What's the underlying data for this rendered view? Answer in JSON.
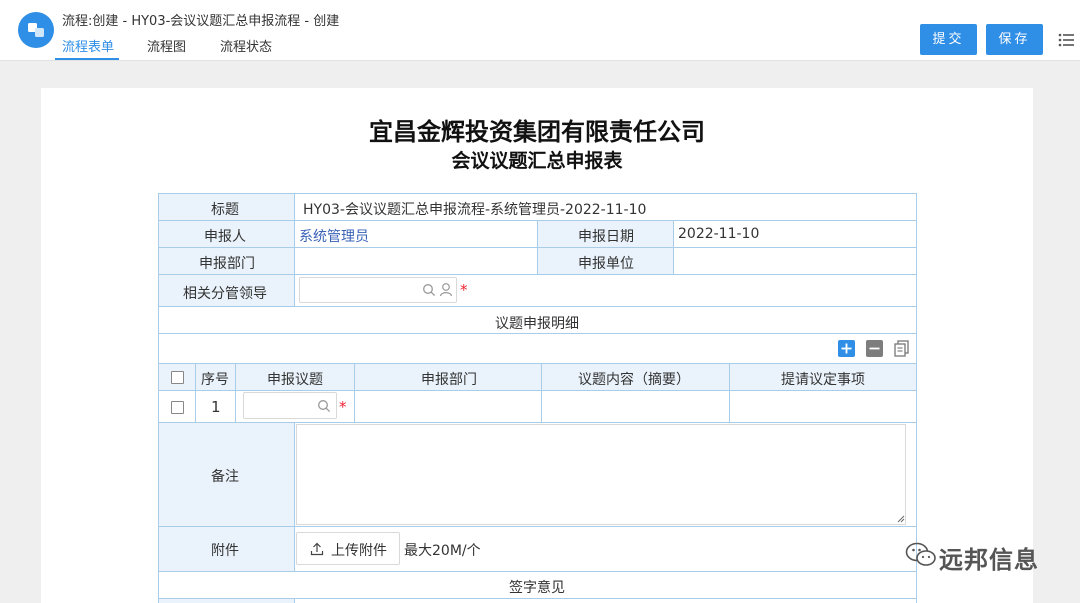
{
  "window": {
    "title": "流程:创建 - HY03-会议议题汇总申报流程 - 创建"
  },
  "tabs": [
    {
      "label": "流程表单",
      "active": true
    },
    {
      "label": "流程图",
      "active": false
    },
    {
      "label": "流程状态",
      "active": false
    }
  ],
  "toolbar": {
    "submit_label": "提交",
    "save_label": "保存",
    "menu_icon": "list-menu-icon",
    "accent": "#2f8ee5"
  },
  "form": {
    "company": "宜昌金辉投资集团有限责任公司",
    "title": "会议议题汇总申报表",
    "fields": {
      "title_label": "标题",
      "title_value": "HY03-会议议题汇总申报流程-系统管理员-2022-11-10",
      "applicant_label": "申报人",
      "applicant_value": "系统管理员",
      "date_label": "申报日期",
      "date_value": "2022-11-10",
      "dept_label": "申报部门",
      "dept_value": "",
      "unit_label": "申报单位",
      "unit_value": "",
      "leader_label": "相关分管领导",
      "leader_value": ""
    },
    "detail": {
      "section_title": "议题申报明细",
      "columns": [
        "序号",
        "申报议题",
        "申报部门",
        "议题内容（摘要）",
        "提请议定事项"
      ],
      "rows": [
        {
          "index": "1",
          "topic": "",
          "dept": "",
          "content": "",
          "matters": ""
        }
      ],
      "actions": [
        "add-row-icon",
        "remove-row-icon",
        "copy-row-icon"
      ]
    },
    "remarks_label": "备注",
    "remarks_value": "",
    "attachment_label": "附件",
    "upload_label": "上传附件",
    "upload_hint": "最大20M/个",
    "sign_section": "签字意见",
    "required_mark": "*"
  },
  "watermark": {
    "text": "远邦信息"
  }
}
